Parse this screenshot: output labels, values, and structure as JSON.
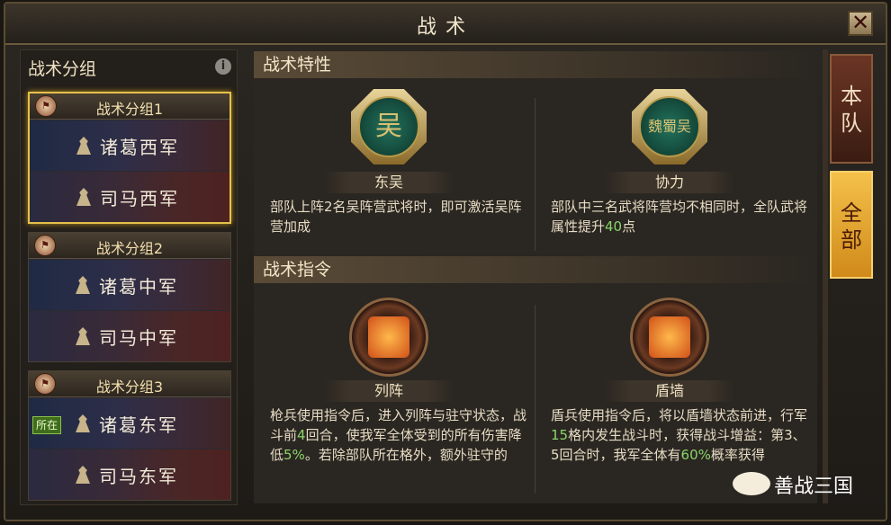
{
  "window": {
    "title": "战术",
    "close_icon": "close-icon"
  },
  "left_panel": {
    "heading": "战术分组",
    "groups": [
      {
        "title": "战术分组1",
        "selected": true,
        "armies": [
          {
            "name": "诸葛西军"
          },
          {
            "name": "司马西军"
          }
        ]
      },
      {
        "title": "战术分组2",
        "selected": false,
        "armies": [
          {
            "name": "诸葛中军"
          },
          {
            "name": "司马中军"
          }
        ]
      },
      {
        "title": "战术分组3",
        "selected": false,
        "armies": [
          {
            "name": "诸葛东军",
            "badge": "所在"
          },
          {
            "name": "司马东军"
          }
        ]
      }
    ]
  },
  "main": {
    "traits": {
      "heading": "战术特性",
      "items": [
        {
          "emblem": "吴",
          "label": "东吴",
          "desc": "部队上阵2名吴阵营武将时，即可激活吴阵营加成"
        },
        {
          "emblem": "魏蜀吴",
          "label": "协力",
          "desc_pre": "部队中三名武将阵营均不相同时，全队武将属性提升",
          "desc_hl": "40",
          "desc_post": "点"
        }
      ]
    },
    "orders": {
      "heading": "战术指令",
      "items": [
        {
          "label": "列阵",
          "desc_a": "枪兵使用指令后，进入列阵与驻守状态，战斗前",
          "desc_hl1": "4",
          "desc_b": "回合，使我军全体受到的所有伤害降低",
          "desc_hl2": "5%",
          "desc_c": "。若除部队所在格外，额外驻守的"
        },
        {
          "label": "盾墙",
          "desc_a": "盾兵使用指令后，将以盾墙状态前进，行军",
          "desc_hl1": "15",
          "desc_b": "格内发生战斗时，获得战斗增益：第3、5回合时，我军全体有",
          "desc_hl2": "60%",
          "desc_c": "概率获得"
        }
      ]
    }
  },
  "tabs": [
    {
      "label": "本队"
    },
    {
      "label": "全部"
    }
  ],
  "watermark": "善战三国",
  "colors": {
    "accent_gold": "#e6c14a",
    "tab_active": "#f4c14a",
    "highlight_green": "#8bd56a"
  }
}
